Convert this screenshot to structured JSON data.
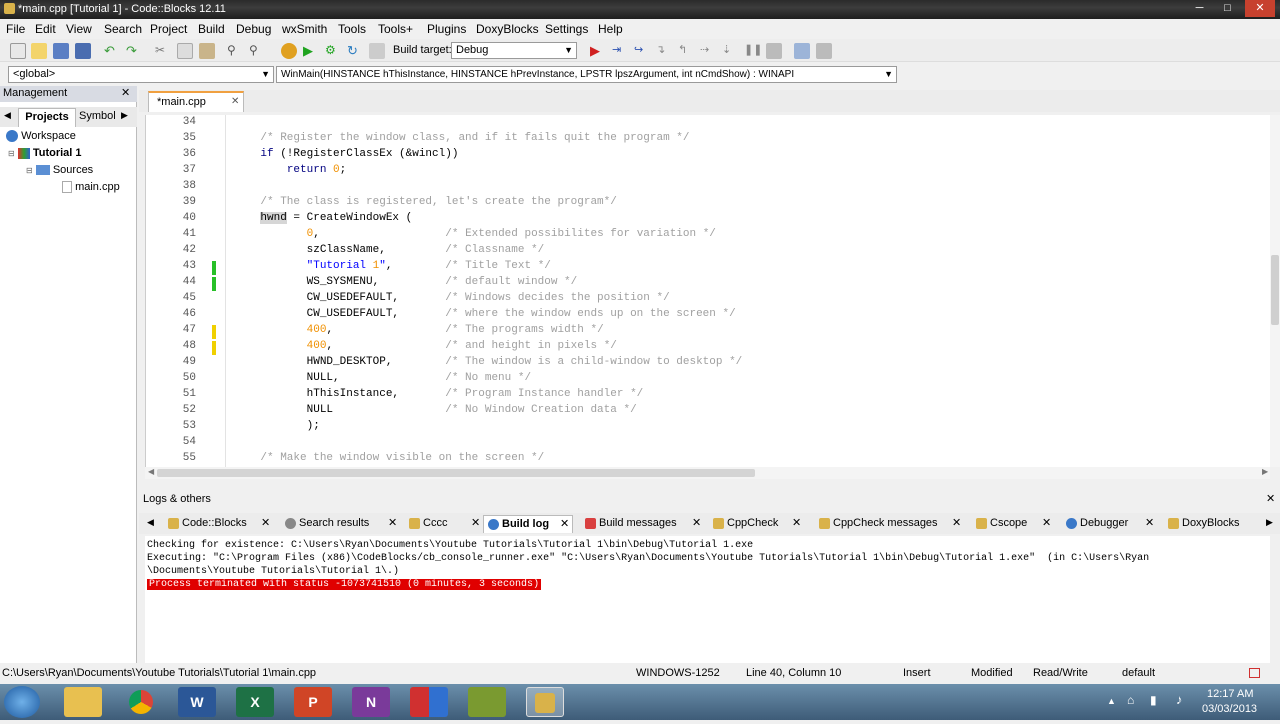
{
  "window": {
    "title": "*main.cpp [Tutorial 1] - Code::Blocks 12.11",
    "minimize": "─",
    "maximize": "□",
    "close": "✕"
  },
  "menu": [
    "File",
    "Edit",
    "View",
    "Search",
    "Project",
    "Build",
    "Debug",
    "wxSmith",
    "Tools",
    "Tools+",
    "Plugins",
    "DoxyBlocks",
    "Settings",
    "Help"
  ],
  "toolbar": {
    "build_target_label": "Build target:",
    "build_target_value": "Debug"
  },
  "codebar": {
    "scope": "<global>",
    "function": "WinMain(HINSTANCE hThisInstance, HINSTANCE hPrevInstance, LPSTR lpszArgument, int nCmdShow) : WINAPI"
  },
  "management": {
    "title": "Management",
    "close": "✕",
    "tabs": [
      "Projects",
      "Symbol"
    ],
    "tree": {
      "workspace": "Workspace",
      "project": "Tutorial 1",
      "folder": "Sources",
      "file": "main.cpp"
    }
  },
  "editor": {
    "tab": "*main.cpp",
    "tab_close": "✕",
    "lines": [
      {
        "n": "34",
        "t": ""
      },
      {
        "n": "35",
        "t": "    /* Register the window class, and if it fails quit the program */"
      },
      {
        "n": "36",
        "t": "    if (!RegisterClassEx (&wincl))"
      },
      {
        "n": "37",
        "t": "        return 0;"
      },
      {
        "n": "38",
        "t": ""
      },
      {
        "n": "39",
        "t": "    /* The class is registered, let's create the program*/"
      },
      {
        "n": "40",
        "t": "    hwnd = CreateWindowEx ("
      },
      {
        "n": "41",
        "t": "           0,                   /* Extended possibilites for variation */"
      },
      {
        "n": "42",
        "t": "           szClassName,         /* Classname */"
      },
      {
        "n": "43",
        "t": "           \"Tutorial 1\",        /* Title Text */"
      },
      {
        "n": "44",
        "t": "           WS_SYSMENU,          /* default window */"
      },
      {
        "n": "45",
        "t": "           CW_USEDEFAULT,       /* Windows decides the position */"
      },
      {
        "n": "46",
        "t": "           CW_USEDEFAULT,       /* where the window ends up on the screen */"
      },
      {
        "n": "47",
        "t": "           400,                 /* The programs width */"
      },
      {
        "n": "48",
        "t": "           400,                 /* and height in pixels */"
      },
      {
        "n": "49",
        "t": "           HWND_DESKTOP,        /* The window is a child-window to desktop */"
      },
      {
        "n": "50",
        "t": "           NULL,                /* No menu */"
      },
      {
        "n": "51",
        "t": "           hThisInstance,       /* Program Instance handler */"
      },
      {
        "n": "52",
        "t": "           NULL                 /* No Window Creation data */"
      },
      {
        "n": "53",
        "t": "           );"
      },
      {
        "n": "54",
        "t": ""
      },
      {
        "n": "55",
        "t": "    /* Make the window visible on the screen */"
      }
    ]
  },
  "logs": {
    "title": "Logs & others",
    "close": "✕",
    "tabs": [
      "Code::Blocks",
      "Search results",
      "Cccc",
      "Build log",
      "Build messages",
      "CppCheck",
      "CppCheck messages",
      "Cscope",
      "Debugger",
      "DoxyBlocks"
    ],
    "lines": [
      "Checking for existence: C:\\Users\\Ryan\\Documents\\Youtube Tutorials\\Tutorial 1\\bin\\Debug\\Tutorial 1.exe",
      "Executing: \"C:\\Program Files (x86)\\CodeBlocks/cb_console_runner.exe\" \"C:\\Users\\Ryan\\Documents\\Youtube Tutorials\\Tutorial 1\\bin\\Debug\\Tutorial 1.exe\"  (in C:\\Users\\Ryan",
      "\\Documents\\Youtube Tutorials\\Tutorial 1\\.)"
    ],
    "error": "Process terminated with status -1073741510 (0 minutes, 3 seconds)"
  },
  "status": {
    "path": "C:\\Users\\Ryan\\Documents\\Youtube Tutorials\\Tutorial 1\\main.cpp",
    "encoding": "WINDOWS-1252",
    "position": "Line 40, Column 10",
    "mode": "Insert",
    "modified": "Modified",
    "access": "Read/Write",
    "profile": "default"
  },
  "taskbar": {
    "time": "12:17 AM",
    "date": "03/03/2013",
    "apps": [
      "W",
      "X",
      "P",
      "N"
    ]
  },
  "colors": {
    "accent": "#3a78c8",
    "error_bg": "#e00000",
    "change_green": "#28c028",
    "change_yellow": "#f0d000"
  }
}
